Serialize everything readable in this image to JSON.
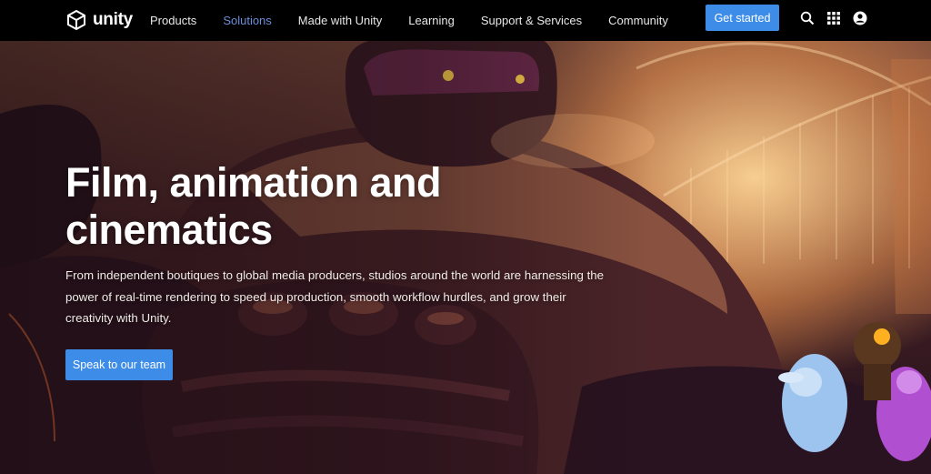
{
  "brand": {
    "name": "unity",
    "accent": "#3d8de8",
    "active_link": "#6c8fd9"
  },
  "nav": {
    "links": [
      {
        "label": "Products",
        "active": false
      },
      {
        "label": "Solutions",
        "active": true
      },
      {
        "label": "Made with Unity",
        "active": false
      },
      {
        "label": "Learning",
        "active": false
      },
      {
        "label": "Support & Services",
        "active": false
      },
      {
        "label": "Community",
        "active": false
      }
    ],
    "cta_label": "Get started",
    "icons": [
      "search-icon",
      "apps-grid-icon",
      "account-icon"
    ]
  },
  "hero": {
    "title": "Film, animation and cinematics",
    "body": "From independent boutiques to global media producers, studios around the world are harnessing the power of real-time rendering to speed up production, smooth workflow hurdles, and grow their creativity with Unity.",
    "button_label": "Speak to our team"
  }
}
